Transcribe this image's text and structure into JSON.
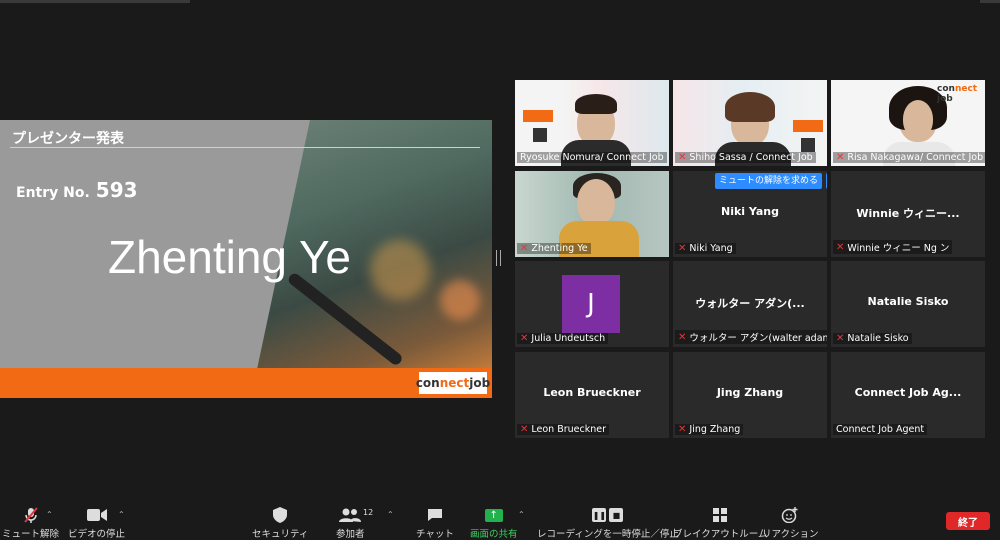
{
  "slide": {
    "title": "プレゼンター発表",
    "entry_label": "Entry No.",
    "entry_number": "593",
    "presenter_name": "Zhenting Ye",
    "logo_a": "con",
    "logo_b": "nect",
    "logo_c": " job"
  },
  "participants": [
    {
      "label": "Ryosuke Nomura/ Connect Job",
      "muted": false,
      "video": true,
      "active": true
    },
    {
      "label": "Shiho Sassa / Connect Job",
      "muted": true,
      "video": true
    },
    {
      "label": "Risa Nakagawa/ Connect Job",
      "muted": true,
      "video": true
    },
    {
      "label": "Zhenting Ye",
      "muted": true,
      "video": true
    },
    {
      "center": "Niki Yang",
      "label": "Niki Yang",
      "muted": true
    },
    {
      "center": "Winnie ウィニー...",
      "label": "Winnie ウィニー Ng ン",
      "muted": true
    },
    {
      "avatar": "J",
      "label": "Julia Undeutsch",
      "muted": true
    },
    {
      "center": "ウォルター アダン(...",
      "label": "ウォルター アダン(walter adant)",
      "muted": true
    },
    {
      "center": "Natalie Sisko",
      "label": "Natalie Sisko",
      "muted": true
    },
    {
      "center": "Leon Brueckner",
      "label": "Leon Brueckner",
      "muted": true
    },
    {
      "center": "Jing Zhang",
      "label": "Jing Zhang",
      "muted": true
    },
    {
      "center": "Connect Job Ag...",
      "label": "Connect Job Agent",
      "muted": false
    }
  ],
  "unmute_request": "ミュートの解除を求める",
  "more": "···",
  "toolbar": {
    "unmute": "ミュート解除",
    "stop_video": "ビデオの停止",
    "security": "セキュリティ",
    "participants": "参加者",
    "participants_count": "12",
    "chat": "チャット",
    "share_screen": "画面の共有",
    "recording": "レコーディングを一時停止／停止",
    "breakout": "ブレイクアウトルーム",
    "reactions": "リアクション",
    "end": "終了"
  },
  "colors": {
    "accent_orange": "#f26a14",
    "share_green": "#22b14c",
    "end_red": "#e02828",
    "active_speaker": "#c6e33b"
  }
}
